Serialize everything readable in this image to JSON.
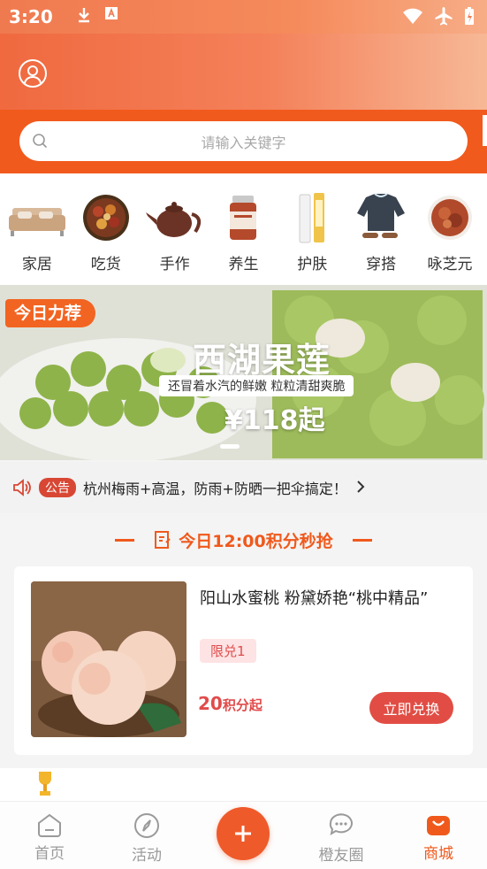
{
  "status_bar": {
    "time": "3:20"
  },
  "search": {
    "placeholder": "请输入关键字"
  },
  "categories": [
    {
      "label": "家居"
    },
    {
      "label": "吃货"
    },
    {
      "label": "手作"
    },
    {
      "label": "养生"
    },
    {
      "label": "护肤"
    },
    {
      "label": "穿搭"
    },
    {
      "label": "咏芝元"
    }
  ],
  "banner": {
    "tag": "今日力荐",
    "headline": "西湖果莲",
    "subtitle": "还冒着水汽的鲜嫩 粒粒清甜爽脆",
    "price": "¥118起"
  },
  "notice": {
    "badge": "公告",
    "text": "杭州梅雨+高温，防雨+防晒一把伞搞定！"
  },
  "flash_sale": {
    "title": "今日12:00积分秒抢"
  },
  "product": {
    "title": "阳山水蜜桃 粉黛娇艳“桃中精品”",
    "limit": "限兑1",
    "points_num": "20",
    "points_unit": "积分起",
    "button": "立即兑换"
  },
  "tabbar": {
    "home": "首页",
    "activity": "活动",
    "friends": "橙友圈",
    "mall": "商城"
  },
  "colors": {
    "brand": "#f15a1d",
    "accent_red": "#e14d44"
  }
}
